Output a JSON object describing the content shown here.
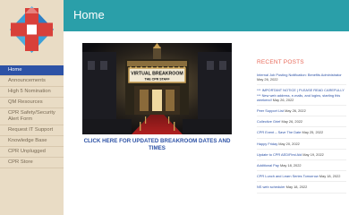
{
  "header": {
    "title": "Home"
  },
  "sidebar": {
    "items": [
      {
        "label": "Home",
        "active": true
      },
      {
        "label": "Announcements",
        "active": false
      },
      {
        "label": "High 5 Nomination",
        "active": false
      },
      {
        "label": "QM Resources",
        "active": false
      },
      {
        "label": "CPR Safety/Security Alert Form",
        "active": false
      },
      {
        "label": "Request IT Support",
        "active": false
      },
      {
        "label": "Knowledge Base",
        "active": false
      },
      {
        "label": "CPR Unplugged",
        "active": false
      },
      {
        "label": "CPR Store",
        "active": false
      }
    ]
  },
  "hero": {
    "marquee_line1": "VIRTUAL BREAKROOM",
    "marquee_line2": "THE CPR STAFF"
  },
  "main": {
    "cta_label": "CLICK HERE FOR UPDATED BREAKROOM DATES AND TIMES"
  },
  "recent_posts": {
    "heading": "RECENT POSTS",
    "items": [
      {
        "title": "Internal Job Posting Notification: Benefits Administrator",
        "date": "May 26, 2022"
      },
      {
        "title": "*** IMPORTANT NOTICE | PLEASE READ CAREFULLY *** New web address, e-mails, and logins, starting this weekend!",
        "date": "May 26, 2022"
      },
      {
        "title": "Peer Support List",
        "date": "May 26, 2022"
      },
      {
        "title": "Collective Grief",
        "date": "May 26, 2022"
      },
      {
        "title": "CPR Event – Save The Date",
        "date": "May 25, 2022"
      },
      {
        "title": "Happy Friday",
        "date": "May 20, 2022"
      },
      {
        "title": "Update to CPR AED/First Aid",
        "date": "May 19, 2022"
      },
      {
        "title": "Additional Pay",
        "date": "May 18, 2022"
      },
      {
        "title": "CPR Lunch and Learn Series Tomorrow",
        "date": "May 18, 2022"
      },
      {
        "title": "NS web scheduler",
        "date": "May 18, 2022"
      }
    ]
  },
  "colors": {
    "header_bg": "#2a9fa9",
    "sidebar_bg": "#e9dcc5",
    "active_nav_bg": "#2d52a6",
    "link": "#2d52a6",
    "accent": "#e86a5a"
  },
  "icons": {
    "logo": "medical-cross-logo"
  }
}
